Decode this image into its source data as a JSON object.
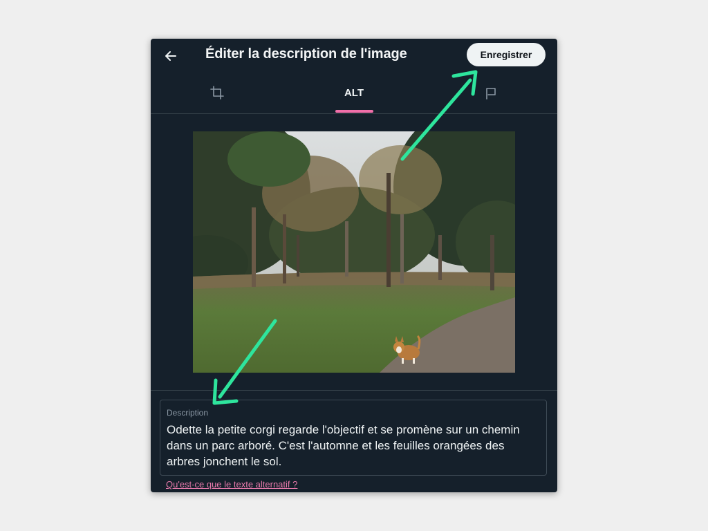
{
  "dialog": {
    "title": "Éditer la description de l'image",
    "save_label": "Enregistrer",
    "back_icon": "arrow-left-icon"
  },
  "tabs": [
    {
      "icon": "crop-icon",
      "label": ""
    },
    {
      "label": "ALT",
      "active": true
    },
    {
      "icon": "flag-icon",
      "label": ""
    }
  ],
  "image": {
    "subject": "autumn park with trees, a path and a corgi"
  },
  "description": {
    "label": "Description",
    "value": "Odette la petite corgi regarde l'objectif et se promène sur un chemin dans un parc arboré. C'est l'automne et les feuilles orangées des arbres jonchent le sol."
  },
  "help_link": "Qu'est-ce que le texte alternatif ?",
  "colors": {
    "background": "#efefef",
    "dialog": "#15202b",
    "accent_tab": "#f06fa9",
    "link": "#e87aac",
    "annotation_arrow": "#2ee59d"
  }
}
